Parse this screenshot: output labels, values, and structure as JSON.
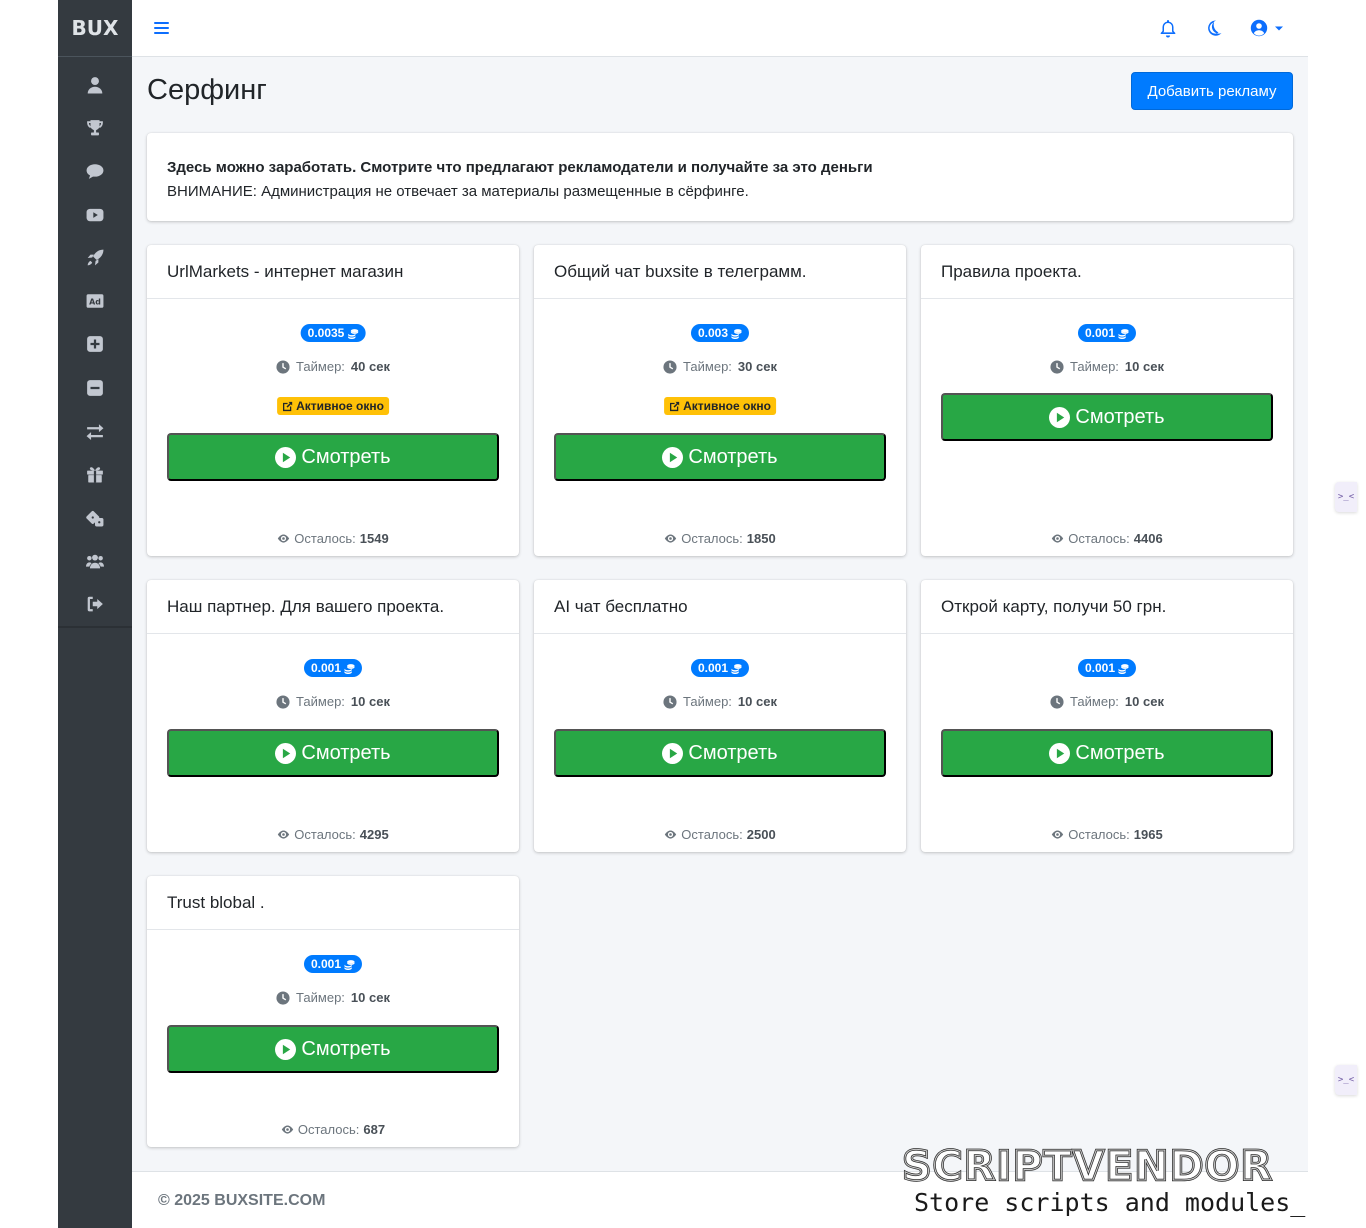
{
  "brand": "BUX",
  "sidebar": {
    "items": [
      {
        "icon": "user-icon"
      },
      {
        "icon": "trophy-icon"
      },
      {
        "icon": "comments-icon"
      },
      {
        "icon": "youtube-icon"
      },
      {
        "icon": "rocket-icon"
      },
      {
        "icon": "ad-icon"
      },
      {
        "icon": "plus-square-icon"
      },
      {
        "icon": "minus-square-icon"
      },
      {
        "icon": "exchange-icon"
      },
      {
        "icon": "gift-icon"
      },
      {
        "icon": "dice-icon"
      },
      {
        "icon": "users-icon"
      },
      {
        "icon": "sign-out-icon"
      }
    ]
  },
  "topbar": {
    "icons": [
      "menu-icon",
      "bell-icon",
      "moon-icon",
      "user-circle-icon",
      "caret-down-icon"
    ]
  },
  "page": {
    "title": "Серфинг",
    "add_button": "Добавить рекламу"
  },
  "notice": {
    "headline": "Здесь можно заработать. Смотрите что предлагают рекламодатели и получайте за это деньги",
    "warning": "ВНИМАНИЕ: Администрация не отвечает за материалы размещенные в сёрфинге."
  },
  "labels": {
    "timer": "Таймер:",
    "remaining": "Осталось:",
    "watch": "Смотреть",
    "active_window": "Активное окно"
  },
  "cards": [
    {
      "title": "UrlMarkets - интернет магазин",
      "price": "0.0035",
      "timer": "40 сек",
      "active_window": true,
      "remaining": "1549"
    },
    {
      "title": "Общий чат buxsite в телеграмм.",
      "price": "0.003",
      "timer": "30 сек",
      "active_window": true,
      "remaining": "1850"
    },
    {
      "title": "Правила проекта.",
      "price": "0.001",
      "timer": "10 сек",
      "active_window": false,
      "remaining": "4406"
    },
    {
      "title": "Наш партнер. Для вашего проекта.",
      "price": "0.001",
      "timer": "10 сек",
      "active_window": false,
      "remaining": "4295"
    },
    {
      "title": "AI чат бесплатно",
      "price": "0.001",
      "timer": "10 сек",
      "active_window": false,
      "remaining": "2500"
    },
    {
      "title": "Открой карту, получи 50 грн.",
      "price": "0.001",
      "timer": "10 сек",
      "active_window": false,
      "remaining": "1965"
    },
    {
      "title": "Trust blobal .",
      "price": "0.001",
      "timer": "10 сек",
      "active_window": false,
      "remaining": "687"
    }
  ],
  "footer": {
    "copyright": "© 2025 BUXSITE.COM"
  },
  "side_tabs": [
    ">_<",
    ">_<"
  ],
  "watermark": {
    "logo": "SCRIPTVENDOR",
    "tagline": "Store scripts and modules_"
  },
  "colors": {
    "sidebar": "#343a40",
    "primary": "#007bff",
    "success": "#28a745",
    "warning": "#ffc107",
    "content_bg": "#f4f6f9"
  }
}
